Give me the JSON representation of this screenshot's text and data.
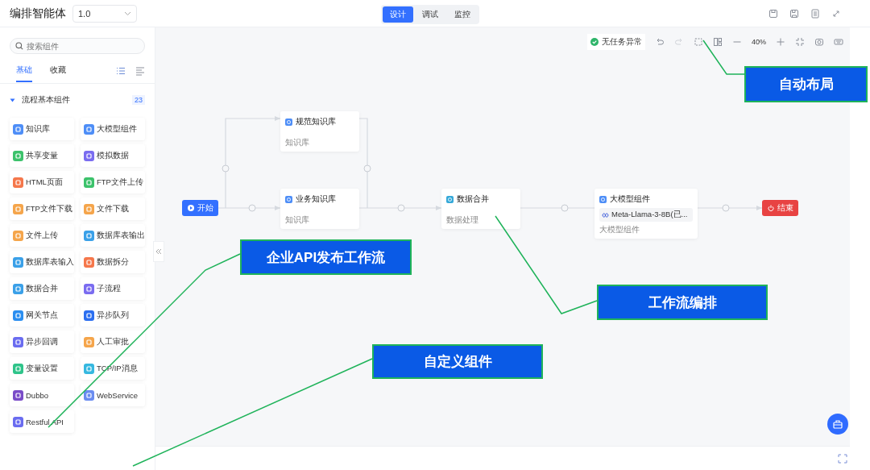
{
  "header": {
    "title": "编排智能体",
    "version": "1.0",
    "tabs": [
      {
        "label": "设计",
        "selected": true
      },
      {
        "label": "调试",
        "selected": false
      },
      {
        "label": "监控",
        "selected": false
      }
    ]
  },
  "sidebar": {
    "search": {
      "placeholder": "搜索组件"
    },
    "tabs": [
      {
        "label": "基础",
        "selected": true
      },
      {
        "label": "收藏",
        "selected": false
      }
    ],
    "section": {
      "title": "流程基本组件",
      "count": "23",
      "expanded": true,
      "items": [
        {
          "label": "知识库",
          "color": "#4e8ef7"
        },
        {
          "label": "大模型组件",
          "color": "#4e8ef7"
        },
        {
          "label": "共享变量",
          "color": "#3cc26b"
        },
        {
          "label": "模拟数据",
          "color": "#7a6cf0"
        },
        {
          "label": "HTML页面",
          "color": "#f5774b"
        },
        {
          "label": "FTP文件上传",
          "color": "#3cc26b"
        },
        {
          "label": "FTP文件下载",
          "color": "#f5a54b"
        },
        {
          "label": "文件下载",
          "color": "#f5a54b"
        },
        {
          "label": "文件上传",
          "color": "#f5a54b"
        },
        {
          "label": "数据库表输出",
          "color": "#3aa0e8"
        },
        {
          "label": "数据库表输入",
          "color": "#3aa0e8"
        },
        {
          "label": "数据拆分",
          "color": "#f5774b"
        },
        {
          "label": "数据合并",
          "color": "#3aa0e8"
        },
        {
          "label": "子流程",
          "color": "#7a6cf0"
        },
        {
          "label": "网关节点",
          "color": "#2b8ef0"
        },
        {
          "label": "异步队列",
          "color": "#2b6ef0"
        },
        {
          "label": "异步回调",
          "color": "#6a6cf0"
        },
        {
          "label": "人工审批",
          "color": "#f5a54b"
        },
        {
          "label": "变量设置",
          "color": "#2fc48a"
        },
        {
          "label": "TCP/IP消息",
          "color": "#36b8e0"
        },
        {
          "label": "Dubbo",
          "color": "#7a4cc8"
        },
        {
          "label": "WebService",
          "color": "#6a8cf0"
        },
        {
          "label": "Restful API",
          "color": "#6a6cf0"
        }
      ]
    }
  },
  "canvas": {
    "status": "无任务异常",
    "zoom": "40%",
    "nodes": [
      {
        "kind": "start",
        "label": "开始"
      },
      {
        "kind": "task",
        "title": "规范知识库",
        "subtitle": "知识库"
      },
      {
        "kind": "task",
        "title": "业务知识库",
        "subtitle": "知识库"
      },
      {
        "kind": "task",
        "title": "数据合并",
        "subtitle": "数据处理"
      },
      {
        "kind": "task",
        "title": "大模型组件",
        "model": "Meta-Llama-3-8B(已...",
        "subtitle": "大模型组件"
      },
      {
        "kind": "end",
        "label": "结束"
      }
    ]
  },
  "annotations": [
    {
      "label": "自动布局"
    },
    {
      "label": "企业API发布工作流"
    },
    {
      "label": "工作流编排"
    },
    {
      "label": "自定义组件"
    }
  ]
}
